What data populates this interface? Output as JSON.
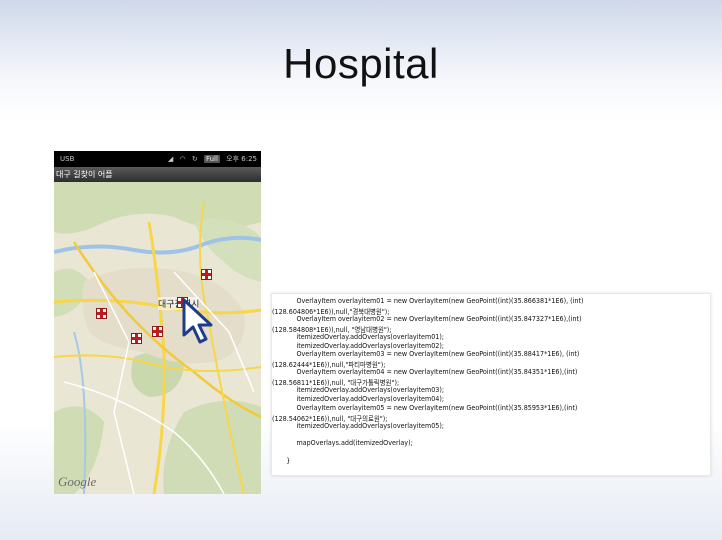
{
  "slide": {
    "title": "Hospital"
  },
  "phone": {
    "status": {
      "usb": "USB",
      "signal": "⁂",
      "full": "Full",
      "time": "오후 6:25"
    },
    "app_title": "대구 길찾이 어플",
    "map": {
      "city_label": "대구광역시",
      "logo": "Google"
    }
  },
  "code": {
    "lines": [
      "            OverlayItem overlayitem01 = new OverlayItem(new GeoPoint((int)(35.866381*1E6), (int)",
      "(128.604806*1E6)),null,\"경북대병원\");",
      "            OverlayItem overlayitem02 = new OverlayItem(new GeoPoint((int)(35.847327*1E6),(int)",
      "(128.584808*1E6)),null, \"영남대병원\");",
      "            itemizedOverlay.addOverlays(overlayitem01);",
      "            itemizedOverlay.addOverlays(overlayitem02);",
      "            OverlayItem overlayitem03 = new OverlayItem(new GeoPoint((int)(35.88417*1E6), (int)",
      "(128.62444*1E6)),null,\"파티마병원\");",
      "            OverlayItem overlayitem04 = new OverlayItem(new GeoPoint((int)(35.84351*1E6),(int)",
      "(128.56811*1E6)),null, \"대구가톨릭병원\");",
      "            itemizedOverlay.addOverlays(overlayitem03);",
      "            itemizedOverlay.addOverlays(overlayitem04);",
      "            OverlayItem overlayitem05 = new OverlayItem(new GeoPoint((int)(35.85953*1E6),(int)",
      "(128.54062*1E6)),null, \"대구의료원\");",
      "            itemizedOverlay.addOverlays(overlayitem05);",
      "",
      "            mapOverlays.add(itemizedOverlay);",
      "",
      "       }"
    ]
  },
  "colors": {
    "marker_red": "#c41a1a",
    "map_base": "#e9e4d2",
    "road_yellow": "#f7d64a"
  }
}
